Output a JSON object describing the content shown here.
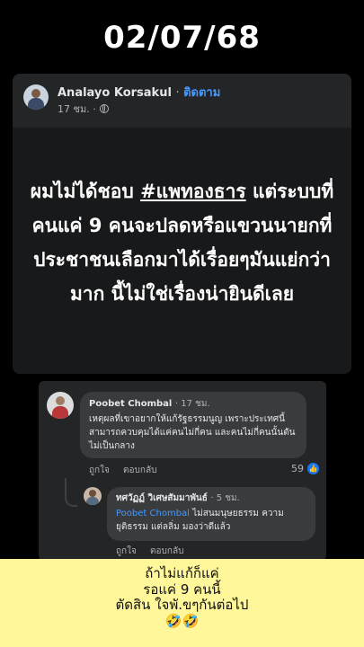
{
  "date_overlay": "02/07/68",
  "post": {
    "author": "Analayo Korsakul",
    "separator": "·",
    "follow_label": "ติดตาม",
    "time": "17 ชม. ·",
    "privacy_icon": "globe-icon",
    "text_before_hashtag": "ผมไม่ได้ชอบ ",
    "hashtag": "#แพทองธาร",
    "text_after_hashtag": " แต่ระบบที่คนแค่ 9 คนจะปลดหรือแขวนนายกที่ประชาชนเลือกมาได้เรื่อยๆมันแย่กว่ามาก นี้ไม่ใช่เรื่องน่ายินดีเลย"
  },
  "comments": [
    {
      "name": "Poobet Chombal",
      "time": "· 17 ชม.",
      "text": "เหตุผลที่เขาอยากให้แก้รัฐธรรมนูญ เพราะประเทศนี้สามารถควบคุมได้แค่คนไม่กี่คน และคนไม่กี่คนนั้นดันไม่เป็นกลาง",
      "like_label": "ถูกใจ",
      "reply_label": "ตอบกลับ",
      "reaction_count": "59"
    },
    {
      "name": "ทศวัฏฏ์ วิเศษสัมมาพันธ์",
      "time": "· 5 ชม.",
      "mention": "Poobet Chombal",
      "text": " ไม่สนมนุษยธรรม ความยุติธรรม แต่ลลิ่ม มองว่าดีแล้ว",
      "like_label": "ถูกใจ",
      "reply_label": "ตอบกลับ"
    }
  ],
  "caption": {
    "line1": "ถ้าไม่แก้ก็แค่",
    "line2": "รอแค่ 9 คนนี้",
    "line3": "ตัดสิน ใจพั.ขๆกันต่อไป",
    "emoji": "🤣🤣"
  },
  "colors": {
    "link": "#4599ff",
    "card": "#242526",
    "caption_bg": "#fff799"
  }
}
